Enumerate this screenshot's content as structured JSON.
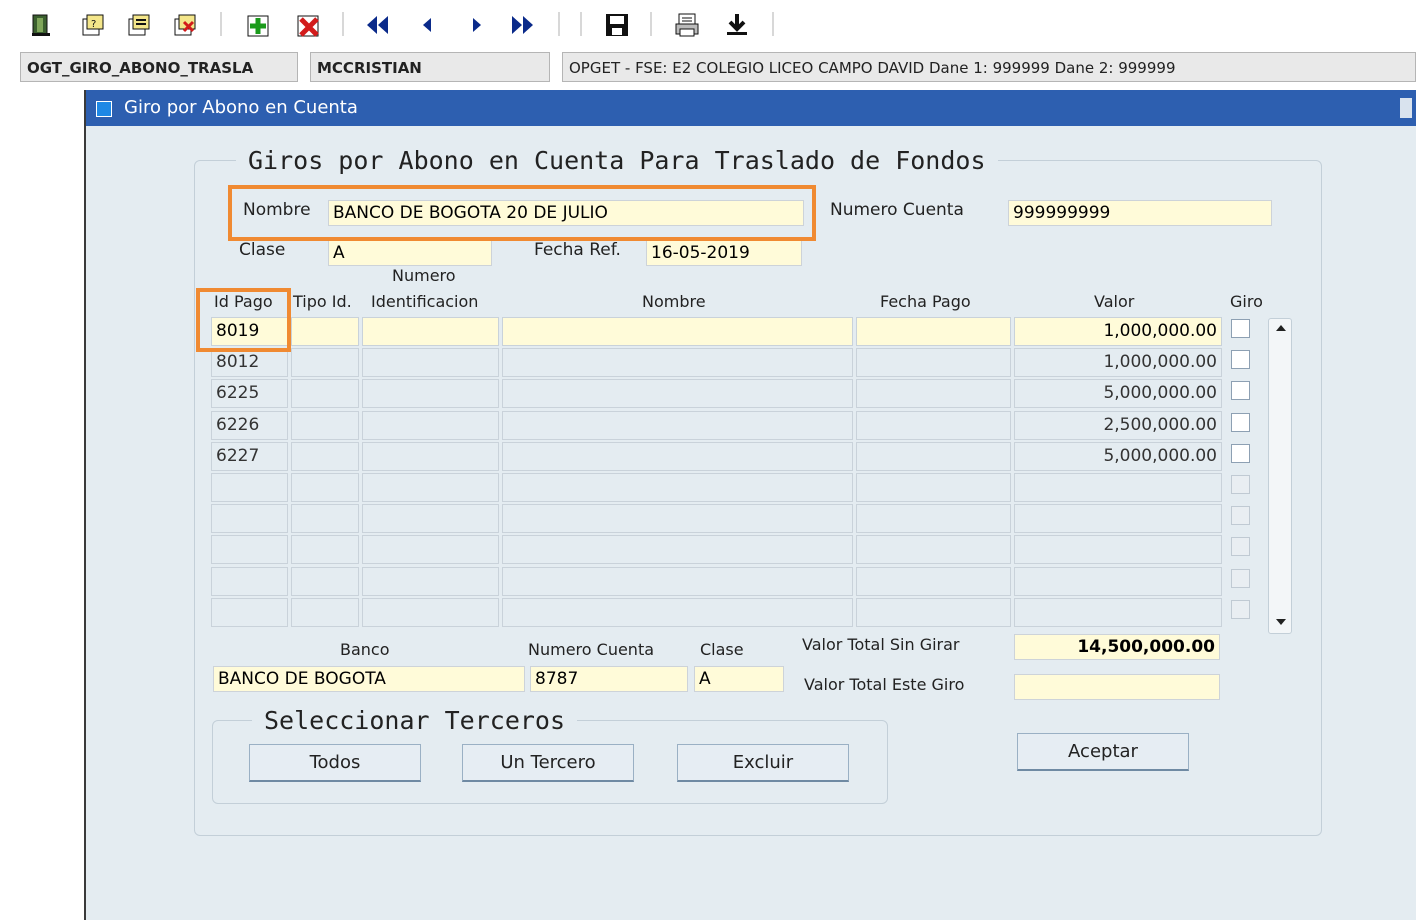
{
  "toolbar": {
    "icons": [
      "exit-icon",
      "query-icon",
      "enter-query-icon",
      "cancel-query-icon",
      "insert-record-icon",
      "delete-record-icon",
      "first-record-icon",
      "previous-record-icon",
      "next-record-icon",
      "last-record-icon",
      "save-icon",
      "print-icon",
      "download-icon"
    ]
  },
  "status": {
    "form_name": "OGT_GIRO_ABONO_TRASLA",
    "user": "MCCRISTIAN",
    "context": "OPGET - FSE: E2 COLEGIO LICEO CAMPO DAVID  Dane 1: 999999  Dane 2: 999999"
  },
  "window": {
    "title": "Giro por Abono en Cuenta"
  },
  "form": {
    "legend": "Giros por Abono en Cuenta Para Traslado de Fondos",
    "nombre_label": "Nombre",
    "nombre_value": "BANCO DE BOGOTA 20 DE JULIO",
    "numero_cuenta_label": "Numero Cuenta",
    "numero_cuenta_value": "999999999",
    "clase_label": "Clase",
    "clase_value": "A",
    "fecha_ref_label": "Fecha Ref.",
    "fecha_ref_value": "16-05-2019"
  },
  "table": {
    "headers": {
      "id_pago": "Id Pago",
      "tipo_id": "Tipo Id.",
      "numero_line1": "Numero",
      "numero_line2": "Identificacion",
      "nombre": "Nombre",
      "fecha_pago": "Fecha Pago",
      "valor": "Valor",
      "giro": "Giro"
    },
    "rows": [
      {
        "id": "8019",
        "valor": "1,000,000.00"
      },
      {
        "id": "8012",
        "valor": "1,000,000.00"
      },
      {
        "id": "6225",
        "valor": "5,000,000.00"
      },
      {
        "id": "6226",
        "valor": "2,500,000.00"
      },
      {
        "id": "6227",
        "valor": "5,000,000.00"
      },
      {
        "id": "",
        "valor": ""
      },
      {
        "id": "",
        "valor": ""
      },
      {
        "id": "",
        "valor": ""
      },
      {
        "id": "",
        "valor": ""
      },
      {
        "id": "",
        "valor": ""
      }
    ]
  },
  "footer": {
    "banco_label": "Banco",
    "banco_value": "BANCO DE BOGOTA",
    "numero_cuenta_label": "Numero Cuenta",
    "numero_cuenta_value": "8787",
    "clase_label": "Clase",
    "clase_value": "A",
    "valor_total_sin_girar_label": "Valor Total Sin Girar",
    "valor_total_sin_girar_value": "14,500,000.00",
    "valor_total_este_giro_label": "Valor Total Este Giro",
    "valor_total_este_giro_value": ""
  },
  "terceros": {
    "legend": "Seleccionar Terceros",
    "todos": "Todos",
    "un_tercero": "Un Tercero",
    "excluir": "Excluir"
  },
  "aceptar": "Aceptar",
  "colors": {
    "title_bar": "#2d5fb0",
    "field_bg": "#fffbd9",
    "window_bg": "#e4ecf1",
    "highlight": "#f08a32"
  }
}
